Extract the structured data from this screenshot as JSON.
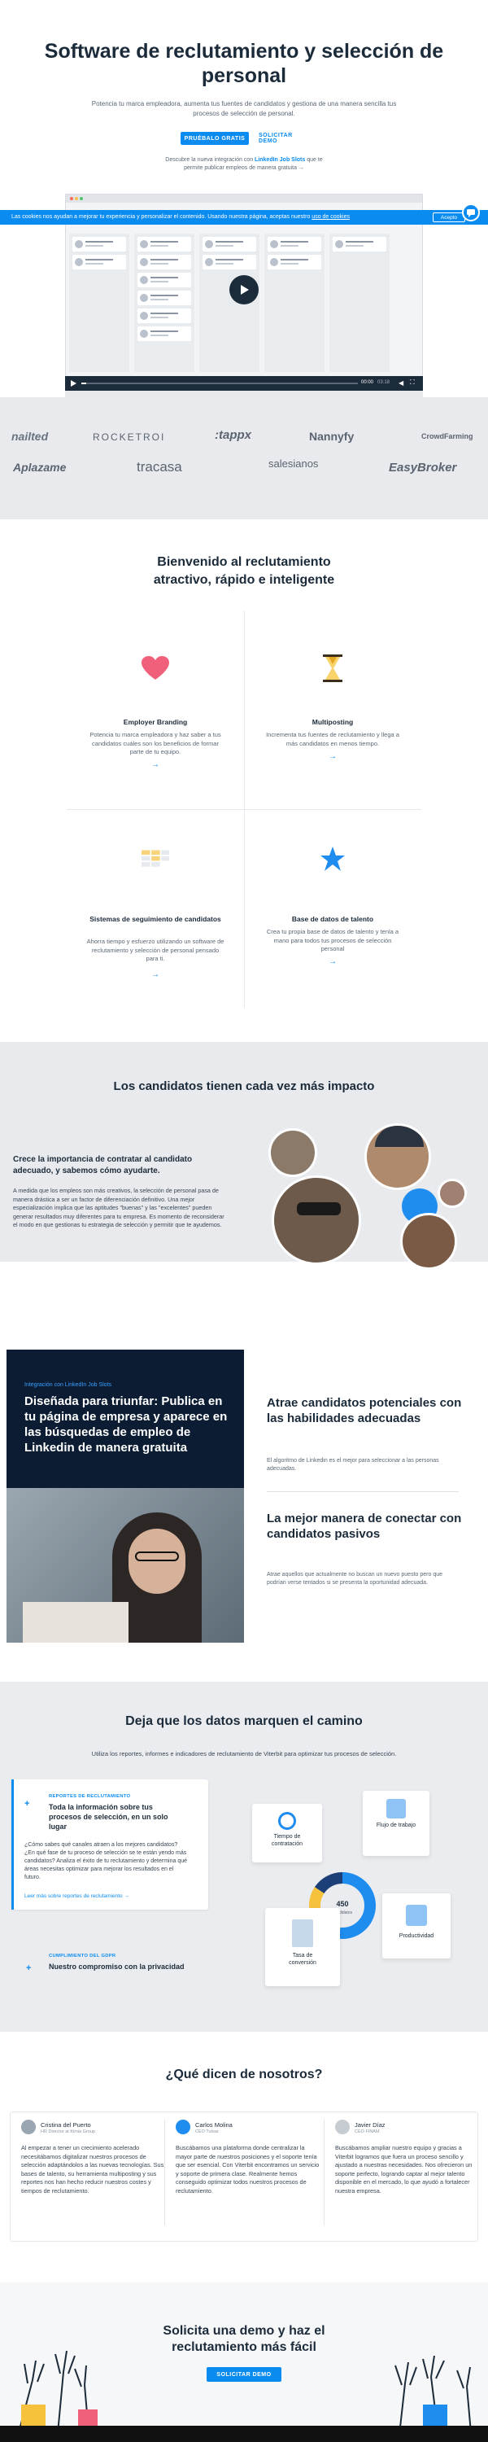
{
  "hero": {
    "title": "Software de reclutamiento y selección de personal",
    "subtitle": "Potencia tu marca empleadora, aumenta tus fuentes de candidatos y gestiona de una manera sencilla tus procesos de selección de personal.",
    "demo_button": "PRUÉBALO GRATIS",
    "demo_link": "SOLICITAR DEMO",
    "note_prefix": "Descubre la nueva integración con",
    "note_link": "LinkedIn Job Slots",
    "note_suffix": "que te permite publicar empleos de manera gratuita →"
  },
  "video": {
    "time": "00:00",
    "duration": "03:18"
  },
  "cookie": {
    "text": "Las cookies nos ayudan a mejorar tu experiencia y personalizar el contenido. Usando nuestra página, aceptas nuestro",
    "link": "uso de cookies",
    "accept": "Acepto"
  },
  "logos": [
    "nailted",
    "ROCKETROI",
    ":tappx",
    "Nannyfy",
    "CrowdFarming",
    "Aplazame",
    "tracasa",
    "salesianos",
    "EasyBroker"
  ],
  "welcome": {
    "title": "Bienvenido al reclutamiento atractivo, rápido e inteligente",
    "features": [
      {
        "title": "Employer Branding",
        "desc": "Potencia tu marca empleadora y haz saber a tus candidatos cuáles son los beneficios de formar parte de tu equipo.",
        "icon": "heart-icon"
      },
      {
        "title": "Multiposting",
        "desc": "Incrementa tus fuentes de reclutamiento y llega a más candidatos en menos tiempo.",
        "icon": "hourglass-icon"
      },
      {
        "title": "Sistemas de seguimiento de candidatos",
        "desc": "Ahorra tiempo y esfuerzo utilizando un software de reclutamiento y selección de personal pensado para ti.",
        "icon": "kanban-icon"
      },
      {
        "title": "Base de datos de talento",
        "desc": "Crea tu propia base de datos de talento y tenla a mano para todos tus procesos de selección personal",
        "icon": "star-icon"
      }
    ]
  },
  "impact": {
    "title": "Los candidatos tienen cada vez más impacto",
    "heading": "Crece la importancia de contratar al candidato adecuado, y sabemos cómo ayudarte.",
    "body": "A medida que los empleos son más creativos, la selección de personal pasa de manera drástica a ser un factor de diferenciación definitivo. Una mejor especialización implica que las aptitudes \"buenas\" y las \"excelentes\" pueden generar resultados muy diferentes para tu empresa. Es momento de reconsiderar el modo en que gestionas tu estrategia de selección y permitir que te ayudemos."
  },
  "linkedin": {
    "tag": "Integración con LinkedIn Job Slots",
    "title_pre": "Diseñada para triunfar: Publica en tu página de empresa y aparece en las búsquedas de empleo de",
    "title_bold": "Linkedin",
    "title_post": "de manera gratuita",
    "h_a": "Atrae candidatos potenciales con las habilidades adecuadas",
    "p_a": "El algoritmo de Linkedin es el mejor para seleccionar a las personas adecuadas.",
    "h_b": "La mejor manera de conectar con candidatos pasivos",
    "p_b": "Atrae aquellos que actualmente no buscan un nuevo puesto pero que podrían verse tentados si se presenta la oportunidad adecuada."
  },
  "data": {
    "title": "Deja que los datos marquen el camino",
    "subtitle": "Utiliza los reportes, informes e indicadores de reclutamiento de Viterbit para optimizar tus procesos de selección.",
    "card_tag": "REPORTES DE RECLUTAMIENTO",
    "card_title": "Toda la información sobre tus procesos de selección, en un solo lugar",
    "card_body": "¿Cómo sabes qué canales atraen a los mejores candidatos? ¿En qué fase de tu proceso de selección se te están yendo más candidatos? Analiza el éxito de tu reclutamiento y determina qué áreas necesitas optimizar para mejorar los resultados en el futuro.",
    "card_link": "Leer más sobre reportes de reclutamiento →",
    "gdpr_tag": "CUMPLIMIENTO DEL GDPR",
    "gdpr_title": "Nuestro compromiso con la privacidad",
    "boxes": {
      "time": "Tiempo de contratación",
      "flow": "Flujo de trabajo",
      "rate": "Tasa de conversión",
      "prod": "Productividad"
    },
    "donut_value": "450",
    "donut_label": "candidatos"
  },
  "testimonials": {
    "title": "¿Qué dicen de nosotros?",
    "items": [
      {
        "name": "Cristina del Puerto",
        "role": "HR Director at Kimia Group",
        "quote": "Al empezar a tener un crecimiento acelerado necesitábamos digitalizar nuestros procesos de selección adaptándolos a las nuevas tecnologías. Sus bases de talento, su herramienta multiposting y sus reportes nos han hecho reducir nuestros costes y tiempos de reclutamiento."
      },
      {
        "name": "Carlos Molina",
        "role": "CEO Tuloar",
        "quote": "Buscábamos una plataforma donde centralizar la mayor parte de nuestros posiciones y el soporte tenía que ser esencial. Con Viterbit encontramos un servicio y soporte de primera clase. Realmente hemos conseguido optimizar todos nuestros procesos de reclutamiento."
      },
      {
        "name": "Javier Díaz",
        "role": "CEO FINAM",
        "quote": "Buscábamos ampliar nuestro equipo y gracias a Viterbit logramos que fuera un proceso sencillo y ajustado a nuestras necesidades. Nos ofrecieron un soporte perfecto, logrando captar al mejor talento disponible en el mercado, lo que ayudó a fortalecer nuestra empresa."
      }
    ]
  },
  "final": {
    "title": "Solicita una demo y haz el reclutamiento más fácil",
    "button": "SOLICITAR DEMO"
  },
  "colors": {
    "accent": "#0a8bf0",
    "dark": "#1c2b3a",
    "band": "#e8eaee",
    "navy": "#0b1c33"
  }
}
